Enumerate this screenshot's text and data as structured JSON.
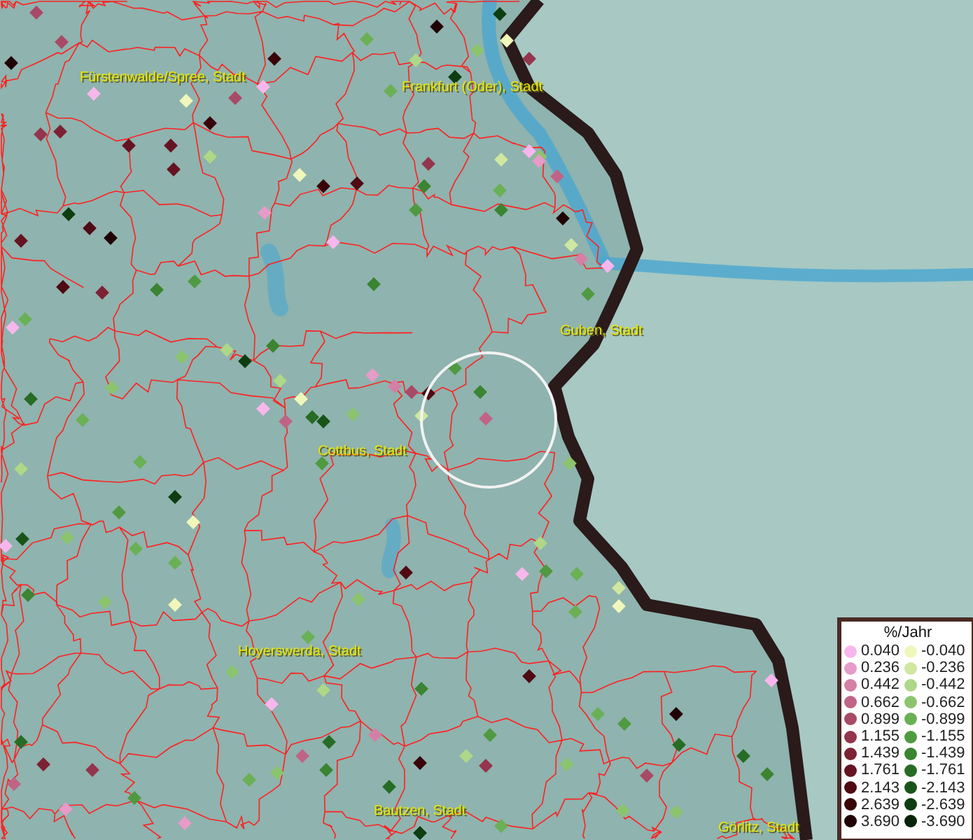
{
  "map": {
    "place_labels": [
      {
        "text": "Fürstenwalde/Spree, Stadt"
      },
      {
        "text": "Frankfurt (Oder), Stadt"
      },
      {
        "text": "Guben, Stadt"
      },
      {
        "text": "Cottbus, Stadt"
      },
      {
        "text": "Hoyerswerda, Stadt"
      },
      {
        "text": "Bautzen, Stadt"
      },
      {
        "text": "Görlitz, Stadt"
      }
    ]
  },
  "legend": {
    "title": "%/Jahr",
    "items": [
      {
        "label": "0.040",
        "color": "#f7b7ec"
      },
      {
        "label": "-0.040",
        "color": "#f0f7bb"
      },
      {
        "label": "0.236",
        "color": "#e69bc8"
      },
      {
        "label": "-0.236",
        "color": "#cfe7a0"
      },
      {
        "label": "0.442",
        "color": "#d47fa6"
      },
      {
        "label": "-0.442",
        "color": "#aed787"
      },
      {
        "label": "0.662",
        "color": "#c06485"
      },
      {
        "label": "-0.662",
        "color": "#8cc46d"
      },
      {
        "label": "0.899",
        "color": "#a84a66"
      },
      {
        "label": "-0.899",
        "color": "#6ab055"
      },
      {
        "label": "1.155",
        "color": "#93354d"
      },
      {
        "label": "-1.155",
        "color": "#4f9a41"
      },
      {
        "label": "1.439",
        "color": "#7c2234"
      },
      {
        "label": "-1.439",
        "color": "#3a8432"
      },
      {
        "label": "1.761",
        "color": "#661321"
      },
      {
        "label": "-1.761",
        "color": "#276c25"
      },
      {
        "label": "2.143",
        "color": "#4f0a13"
      },
      {
        "label": "-2.143",
        "color": "#185419"
      },
      {
        "label": "2.639",
        "color": "#38040a"
      },
      {
        "label": "-2.639",
        "color": "#0d3d10"
      },
      {
        "label": "3.690",
        "color": "#200204"
      },
      {
        "label": "-3.690",
        "color": "#052307"
      }
    ]
  }
}
